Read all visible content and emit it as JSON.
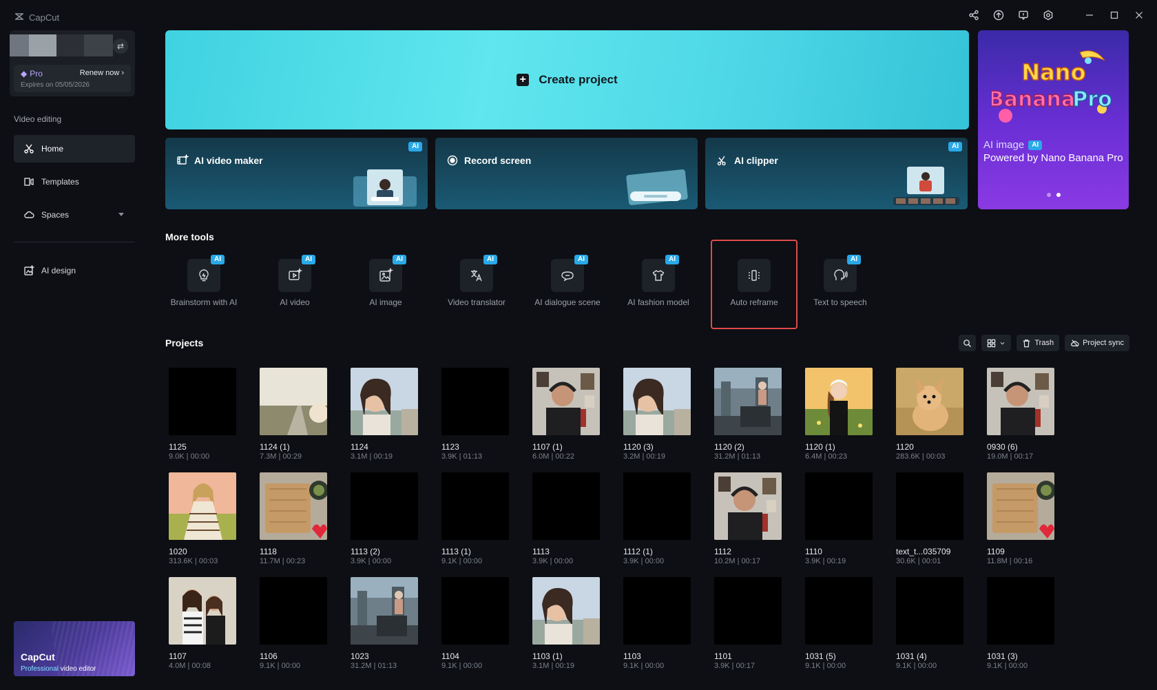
{
  "app": {
    "name": "CapCut"
  },
  "account": {
    "plan": "Pro",
    "renew_label": "Renew now",
    "expires": "Expires on 05/05/2026"
  },
  "sidebar": {
    "section": "Video editing",
    "items": [
      {
        "label": "Home",
        "icon": "home-icon",
        "active": true
      },
      {
        "label": "Templates",
        "icon": "templates-icon"
      },
      {
        "label": "Spaces",
        "icon": "cloud-icon"
      },
      {
        "label": "AI design",
        "icon": "ai-design-icon"
      }
    ],
    "promo": {
      "title": "CapCut",
      "sub_highlight": "Professional",
      "sub_rest": " video editor"
    }
  },
  "create": {
    "label": "Create project"
  },
  "banner": {
    "ai_label": "AI image",
    "ai_tag": "AI",
    "title": "Powered by Nano Banana Pro",
    "art_line1": "Nano",
    "art_line2": "Banana",
    "art_line3": "Pro"
  },
  "features": [
    {
      "label": "AI video maker",
      "tag": "AI"
    },
    {
      "label": "Record screen",
      "tag": ""
    },
    {
      "label": "AI clipper",
      "tag": "AI"
    }
  ],
  "more_tools": {
    "title": "More tools",
    "items": [
      {
        "label": "Brainstorm with AI",
        "tag": "AI"
      },
      {
        "label": "AI video",
        "tag": "AI"
      },
      {
        "label": "AI image",
        "tag": "AI"
      },
      {
        "label": "Video translator",
        "tag": "AI"
      },
      {
        "label": "AI dialogue scene",
        "tag": "AI"
      },
      {
        "label": "AI fashion model",
        "tag": "AI"
      },
      {
        "label": "Auto reframe",
        "tag": ""
      },
      {
        "label": "Text to speech",
        "tag": "AI"
      }
    ]
  },
  "projects": {
    "title": "Projects",
    "trash_label": "Trash",
    "sync_label": "Project sync",
    "items": [
      {
        "name": "1125",
        "meta": "9.0K | 00:00",
        "thumb": "black"
      },
      {
        "name": "1124 (1)",
        "meta": "7.3M | 00:29",
        "thumb": "road"
      },
      {
        "name": "1124",
        "meta": "3.1M | 00:19",
        "thumb": "girl"
      },
      {
        "name": "1123",
        "meta": "3.9K | 01:13",
        "thumb": "black"
      },
      {
        "name": "1107 (1)",
        "meta": "6.0M | 00:22",
        "thumb": "man"
      },
      {
        "name": "1120 (3)",
        "meta": "3.2M | 00:19",
        "thumb": "girl"
      },
      {
        "name": "1120 (2)",
        "meta": "31.2M | 01:13",
        "thumb": "city"
      },
      {
        "name": "1120 (1)",
        "meta": "6.4M | 00:23",
        "thumb": "field"
      },
      {
        "name": "1120",
        "meta": "283.6K | 00:03",
        "thumb": "dog"
      },
      {
        "name": "0930 (6)",
        "meta": "19.0M | 00:17",
        "thumb": "man"
      },
      {
        "name": "1020",
        "meta": "313.6K | 00:03",
        "thumb": "boho"
      },
      {
        "name": "1118",
        "meta": "11.7M | 00:23",
        "thumb": "board"
      },
      {
        "name": "1113 (2)",
        "meta": "3.9K | 00:00",
        "thumb": "black"
      },
      {
        "name": "1113 (1)",
        "meta": "9.1K | 00:00",
        "thumb": "black"
      },
      {
        "name": "1113",
        "meta": "3.9K | 00:00",
        "thumb": "black"
      },
      {
        "name": "1112 (1)",
        "meta": "3.9K | 00:00",
        "thumb": "black"
      },
      {
        "name": "1112",
        "meta": "10.2M | 00:17",
        "thumb": "man"
      },
      {
        "name": "1110",
        "meta": "3.9K | 00:19",
        "thumb": "black"
      },
      {
        "name": "text_t...035709",
        "meta": "30.6K | 00:01",
        "thumb": "black"
      },
      {
        "name": "1109",
        "meta": "11.8M | 00:16",
        "thumb": "board"
      },
      {
        "name": "1107",
        "meta": "4.0M | 00:08",
        "thumb": "friends"
      },
      {
        "name": "1106",
        "meta": "9.1K | 00:00",
        "thumb": "black"
      },
      {
        "name": "1023",
        "meta": "31.2M | 01:13",
        "thumb": "city"
      },
      {
        "name": "1104",
        "meta": "9.1K | 00:00",
        "thumb": "black"
      },
      {
        "name": "1103 (1)",
        "meta": "3.1M | 00:19",
        "thumb": "girl"
      },
      {
        "name": "1103",
        "meta": "9.1K | 00:00",
        "thumb": "black"
      },
      {
        "name": "1101",
        "meta": "3.9K | 00:17",
        "thumb": "black"
      },
      {
        "name": "1031 (5)",
        "meta": "9.1K | 00:00",
        "thumb": "black"
      },
      {
        "name": "1031 (4)",
        "meta": "9.1K | 00:00",
        "thumb": "black"
      },
      {
        "name": "1031 (3)",
        "meta": "9.1K | 00:00",
        "thumb": "black"
      }
    ]
  }
}
